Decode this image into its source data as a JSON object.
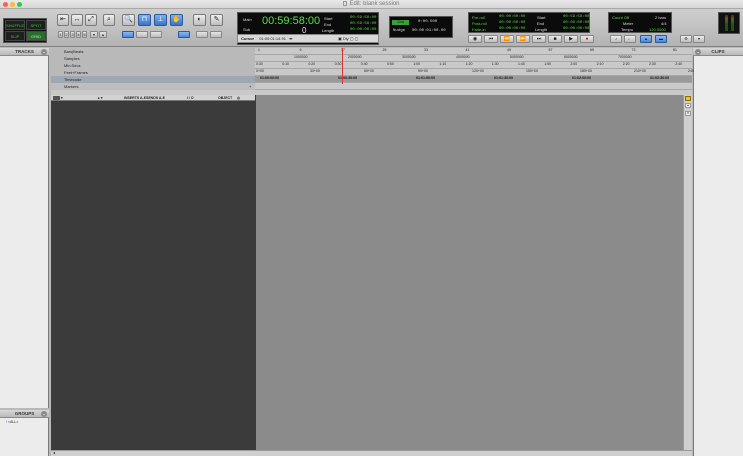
{
  "window": {
    "title": "Edit: blank session"
  },
  "modes": {
    "shuffle": "SHUFFLE",
    "spot": "SPOT",
    "slip": "SLIP",
    "grid": "GRID"
  },
  "counter": {
    "main_label": "Main",
    "sub_label": "Sub",
    "main_value": "00:59:58:00",
    "sub_value": "0",
    "start_label": "Start",
    "end_label": "End",
    "length_label": "Length",
    "start_value": "00:59:58:00",
    "end_value": "00:59:58:00",
    "length_value": "00:00:00:00",
    "cursor_label": "Cursor",
    "cursor_value": "01:00:01:14.91"
  },
  "grid": {
    "grid_label": "Grid",
    "grid_value": "0:00.500",
    "nudge_label": "Nudge",
    "nudge_value": "00:00:01:00.00"
  },
  "selection": {
    "preroll_label": "Pre-roll",
    "postroll_label": "Post-roll",
    "fadein_label": "Fade-in",
    "preroll_value": "00:00:00:00",
    "postroll_value": "00:00:00:00",
    "fadein_value": "00:00:00:00",
    "start_label": "Start",
    "end_label": "End",
    "length_label": "Length",
    "start_value": "00:59:58:00",
    "end_value": "00:00:00:00",
    "length_value": "00:00:00:00"
  },
  "meter": {
    "countoff_label": "Count Off",
    "countoff_value": "2 bars",
    "meter_label": "Meter",
    "meter_value": "4/4",
    "tempo_label": "Tempo",
    "tempo_value": "120.0000"
  },
  "panels": {
    "tracks": "TRACKS",
    "groups": "GROUPS",
    "clips": "CLIPS",
    "group_item": "<ALL>"
  },
  "rulers": {
    "labels": [
      "Bars|Beats",
      "Samples",
      "Min:Secs",
      "Feet+Frames",
      "Timecode",
      "Markers"
    ],
    "bars": [
      "1",
      "9",
      "17",
      "25",
      "33",
      "41",
      "49",
      "57",
      "65",
      "73",
      "81"
    ],
    "samples": [
      "1000000",
      "2000000",
      "3000000",
      "4000000",
      "5000000",
      "6000000",
      "7000000"
    ],
    "minsecs": [
      "0:30",
      "0:10",
      "0:20",
      "0:30",
      "0:40",
      "0:50",
      "1:00",
      "1:10",
      "1:20",
      "1:30",
      "1:40",
      "1:50",
      "2:00",
      "2:10",
      "2:20",
      "2:30",
      "2:40"
    ],
    "feet": [
      "0+00",
      "30+00",
      "60+00",
      "90+00",
      "120+00",
      "150+00",
      "180+00",
      "210+00",
      "240"
    ],
    "timecode": [
      "01:00:00:00",
      "01:00:30:00",
      "01:01:00:00",
      "01:01:30:00",
      "01:02:00:00",
      "01:02:30:00"
    ]
  },
  "columns": {
    "inserts": "INSERTS A-E",
    "sends": "SENDS A-E",
    "io": "I / O",
    "object": "OBJECT"
  }
}
